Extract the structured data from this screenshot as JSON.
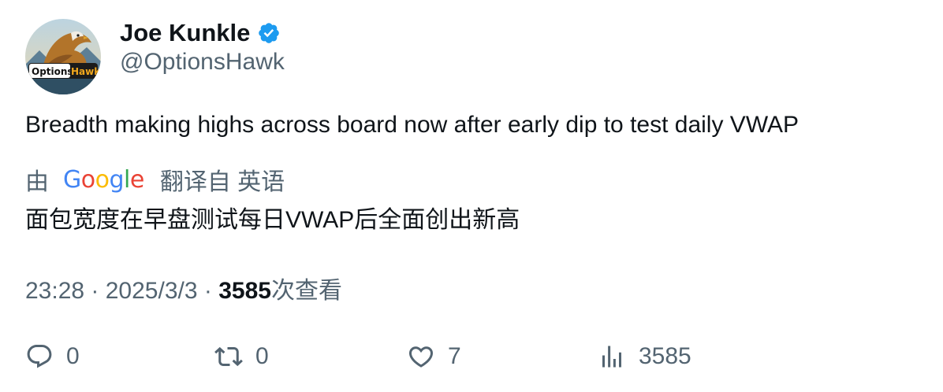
{
  "author": {
    "display_name": "Joe Kunkle",
    "handle": "@OptionsHawk",
    "verified": true,
    "avatar_text": "OptionsHawk"
  },
  "tweet": {
    "text": "Breadth making highs across board now after early dip to test daily VWAP"
  },
  "translation": {
    "by_label": "由",
    "provider_logo": "Google",
    "label": "翻译自 英语",
    "text": "面包宽度在早盘测试每日VWAP后全面创出新高"
  },
  "meta": {
    "time": "23:28",
    "separator": "·",
    "date": "2025/3/3",
    "views_count": "3585",
    "views_label": "次查看"
  },
  "actions": {
    "reply_count": "0",
    "retweet_count": "0",
    "like_count": "7",
    "views_count": "3585"
  },
  "icons": {
    "verified": "verified-badge-icon",
    "reply": "reply-icon",
    "retweet": "retweet-icon",
    "like": "heart-icon",
    "views": "bar-chart-icon"
  },
  "colors": {
    "text_primary": "#0f1419",
    "text_secondary": "#536471",
    "verified_blue": "#1d9bf0"
  }
}
